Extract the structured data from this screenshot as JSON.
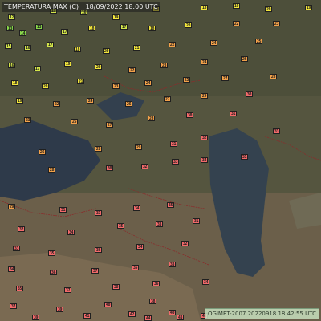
{
  "header": {
    "title": "TEMPERATURA MAX (C)",
    "datetime": "18/09/2022 18:00 UTC"
  },
  "footer": {
    "credit": "OGIMET-2007 20220918 18:42:55 UTC"
  },
  "legend_colors": {
    "yellow": "#f2e53c",
    "yellow_green": "#d4e54a",
    "green": "#88d64a",
    "orange": "#f2a14a",
    "red": "#f26a6a"
  },
  "stations": [
    {
      "v": "12",
      "c": "#d4e54a"
    },
    {
      "v": "17",
      "c": "#d4e54a"
    },
    {
      "v": "16",
      "c": "#d4e54a"
    },
    {
      "v": "19",
      "c": "#f2e53c"
    },
    {
      "v": "20",
      "c": "#f2e53c"
    },
    {
      "v": "18",
      "c": "#f2e53c"
    },
    {
      "v": "19",
      "c": "#f2e53c"
    },
    {
      "v": "20",
      "c": "#f2e53c"
    },
    {
      "v": "19",
      "c": "#f2e53c"
    },
    {
      "v": "13",
      "c": "#88d64a"
    },
    {
      "v": "14",
      "c": "#88d64a"
    },
    {
      "v": "13",
      "c": "#88d64a"
    },
    {
      "v": "17",
      "c": "#d4e54a"
    },
    {
      "v": "18",
      "c": "#f2e53c"
    },
    {
      "v": "17",
      "c": "#d4e54a"
    },
    {
      "v": "18",
      "c": "#f2e53c"
    },
    {
      "v": "20",
      "c": "#f2e53c"
    },
    {
      "v": "22",
      "c": "#f2a14a"
    },
    {
      "v": "23",
      "c": "#f2a14a"
    },
    {
      "v": "15",
      "c": "#d4e54a"
    },
    {
      "v": "16",
      "c": "#d4e54a"
    },
    {
      "v": "17",
      "c": "#d4e54a"
    },
    {
      "v": "18",
      "c": "#f2e53c"
    },
    {
      "v": "20",
      "c": "#f2e53c"
    },
    {
      "v": "21",
      "c": "#f2e53c"
    },
    {
      "v": "22",
      "c": "#f2a14a"
    },
    {
      "v": "24",
      "c": "#f2a14a"
    },
    {
      "v": "25",
      "c": "#f2a14a"
    },
    {
      "v": "16",
      "c": "#d4e54a"
    },
    {
      "v": "17",
      "c": "#d4e54a"
    },
    {
      "v": "19",
      "c": "#f2e53c"
    },
    {
      "v": "20",
      "c": "#f2e53c"
    },
    {
      "v": "22",
      "c": "#f2a14a"
    },
    {
      "v": "23",
      "c": "#f2a14a"
    },
    {
      "v": "24",
      "c": "#f2a14a"
    },
    {
      "v": "26",
      "c": "#f2a14a"
    },
    {
      "v": "18",
      "c": "#f2e53c"
    },
    {
      "v": "20",
      "c": "#f2e53c"
    },
    {
      "v": "21",
      "c": "#f2e53c"
    },
    {
      "v": "23",
      "c": "#f2a14a"
    },
    {
      "v": "24",
      "c": "#f2a14a"
    },
    {
      "v": "25",
      "c": "#f2a14a"
    },
    {
      "v": "27",
      "c": "#f2a14a"
    },
    {
      "v": "28",
      "c": "#f2a14a"
    },
    {
      "v": "19",
      "c": "#f2e53c"
    },
    {
      "v": "22",
      "c": "#f2a14a"
    },
    {
      "v": "24",
      "c": "#f2a14a"
    },
    {
      "v": "26",
      "c": "#f2a14a"
    },
    {
      "v": "27",
      "c": "#f2a14a"
    },
    {
      "v": "29",
      "c": "#f2a14a"
    },
    {
      "v": "30",
      "c": "#f26a6a"
    },
    {
      "v": "23",
      "c": "#f2a14a"
    },
    {
      "v": "25",
      "c": "#f2a14a"
    },
    {
      "v": "27",
      "c": "#f2a14a"
    },
    {
      "v": "28",
      "c": "#f2a14a"
    },
    {
      "v": "30",
      "c": "#f26a6a"
    },
    {
      "v": "31",
      "c": "#f26a6a"
    },
    {
      "v": "26",
      "c": "#f2a14a"
    },
    {
      "v": "28",
      "c": "#f2a14a"
    },
    {
      "v": "29",
      "c": "#f2a14a"
    },
    {
      "v": "31",
      "c": "#f26a6a"
    },
    {
      "v": "32",
      "c": "#f26a6a"
    },
    {
      "v": "33",
      "c": "#f26a6a"
    },
    {
      "v": "28",
      "c": "#f2a14a"
    },
    {
      "v": "30",
      "c": "#f26a6a"
    },
    {
      "v": "32",
      "c": "#f26a6a"
    },
    {
      "v": "33",
      "c": "#f26a6a"
    },
    {
      "v": "34",
      "c": "#f26a6a"
    },
    {
      "v": "31",
      "c": "#f26a6a"
    },
    {
      "v": "29",
      "c": "#f2a14a"
    },
    {
      "v": "31",
      "c": "#f26a6a"
    },
    {
      "v": "33",
      "c": "#f26a6a"
    },
    {
      "v": "34",
      "c": "#f26a6a"
    },
    {
      "v": "35",
      "c": "#f26a6a"
    },
    {
      "v": "32",
      "c": "#f26a6a"
    },
    {
      "v": "34",
      "c": "#f26a6a"
    },
    {
      "v": "35",
      "c": "#f26a6a"
    },
    {
      "v": "33",
      "c": "#f26a6a"
    },
    {
      "v": "31",
      "c": "#f26a6a"
    },
    {
      "v": "33",
      "c": "#f26a6a"
    },
    {
      "v": "35",
      "c": "#f26a6a"
    },
    {
      "v": "36",
      "c": "#f26a6a"
    },
    {
      "v": "34",
      "c": "#f26a6a"
    },
    {
      "v": "32",
      "c": "#f26a6a"
    },
    {
      "v": "34",
      "c": "#f26a6a"
    },
    {
      "v": "36",
      "c": "#f26a6a"
    },
    {
      "v": "37",
      "c": "#f26a6a"
    },
    {
      "v": "35",
      "c": "#f26a6a"
    },
    {
      "v": "33",
      "c": "#f26a6a"
    },
    {
      "v": "35",
      "c": "#f26a6a"
    },
    {
      "v": "37",
      "c": "#f26a6a"
    },
    {
      "v": "38",
      "c": "#f26a6a"
    },
    {
      "v": "36",
      "c": "#f26a6a"
    },
    {
      "v": "34",
      "c": "#f26a6a"
    },
    {
      "v": "37",
      "c": "#f26a6a"
    },
    {
      "v": "39",
      "c": "#f26a6a"
    },
    {
      "v": "40",
      "c": "#f26a6a"
    },
    {
      "v": "38",
      "c": "#f26a6a"
    },
    {
      "v": "39",
      "c": "#f26a6a"
    },
    {
      "v": "41",
      "c": "#f26a6a"
    },
    {
      "v": "42",
      "c": "#f26a6a"
    },
    {
      "v": "40",
      "c": "#f26a6a"
    },
    {
      "v": "44",
      "c": "#f26a6a"
    },
    {
      "v": "43",
      "c": "#f26a6a"
    },
    {
      "v": "41",
      "c": "#f26a6a"
    }
  ]
}
